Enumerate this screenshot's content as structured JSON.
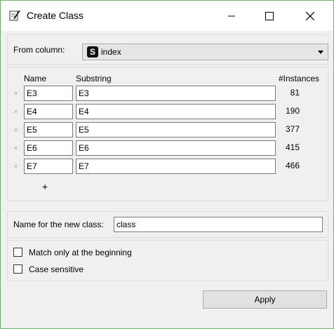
{
  "window": {
    "title": "Create Class"
  },
  "from_column": {
    "label": "From column:",
    "type_badge": "S",
    "value": "index"
  },
  "table": {
    "headers": {
      "name": "Name",
      "substring": "Substring",
      "instances": "#Instances"
    },
    "rows": [
      {
        "remove": "×",
        "name": "E3",
        "substring": "E3",
        "instances": "81"
      },
      {
        "remove": "×",
        "name": "E4",
        "substring": "E4",
        "instances": "190"
      },
      {
        "remove": "×",
        "name": "E5",
        "substring": "E5",
        "instances": "377"
      },
      {
        "remove": "×",
        "name": "E6",
        "substring": "E6",
        "instances": "415"
      },
      {
        "remove": "×",
        "name": "E7",
        "substring": "E7",
        "instances": "466"
      }
    ],
    "add_label": "+"
  },
  "new_class": {
    "label": "Name for the new class:",
    "value": "class"
  },
  "options": {
    "match_beginning": {
      "label": "Match only at the beginning",
      "checked": false
    },
    "case_sensitive": {
      "label": "Case sensitive",
      "checked": false
    }
  },
  "apply_label": "Apply"
}
